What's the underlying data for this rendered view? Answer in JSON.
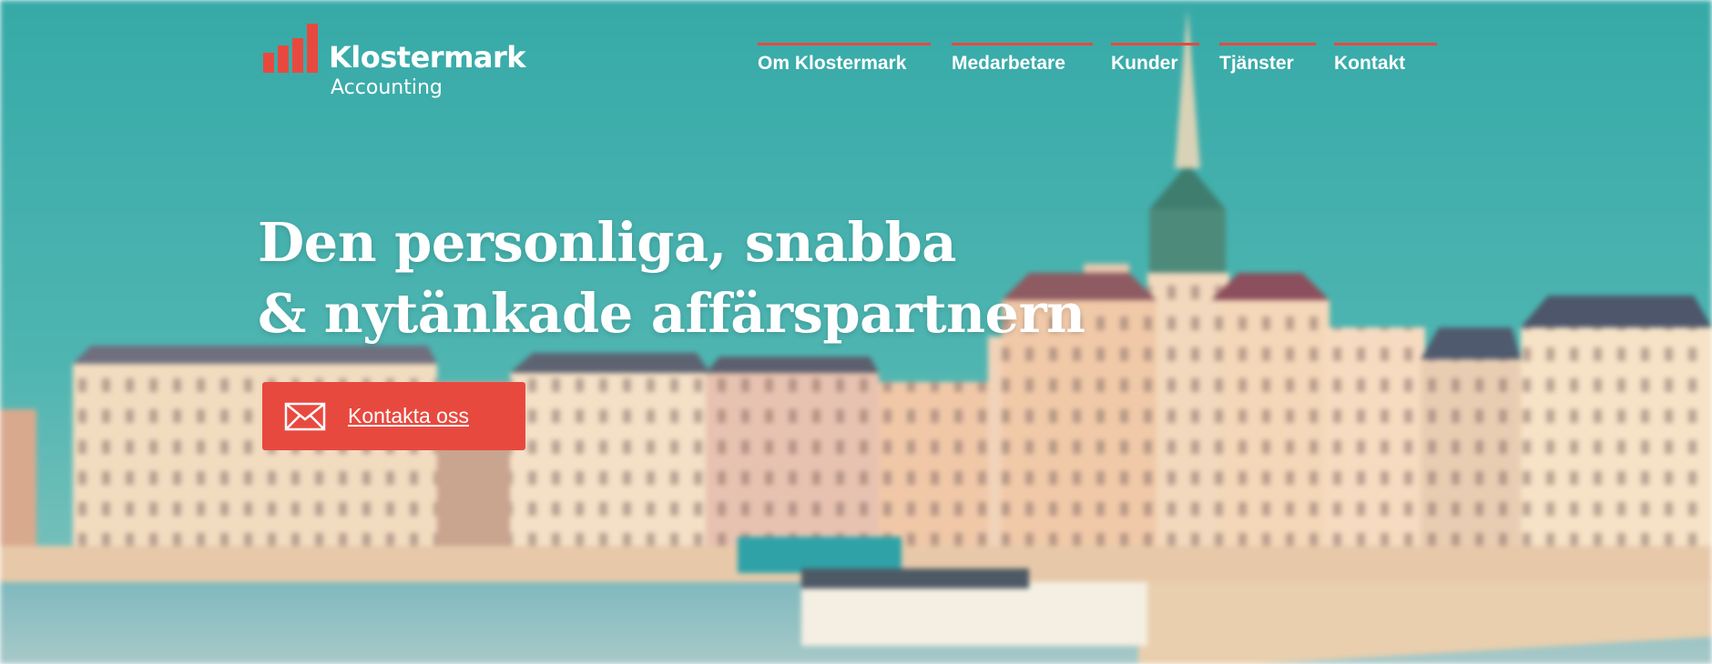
{
  "brand": {
    "name": "Klostermark",
    "tagline": "Accounting",
    "accent_color": "#e8493f"
  },
  "nav": {
    "items": [
      {
        "label": "Om Klostermark"
      },
      {
        "label": "Medarbetare"
      },
      {
        "label": "Kunder"
      },
      {
        "label": "Tjänster"
      },
      {
        "label": "Kontakt"
      }
    ]
  },
  "hero": {
    "headline_line1": "Den personliga, snabba",
    "headline_line2": "& nytänkade affärspartnern",
    "cta_label": "Kontakta oss",
    "cta_icon": "envelope-icon",
    "background": "blurred-stockholm-waterfront-photo"
  }
}
